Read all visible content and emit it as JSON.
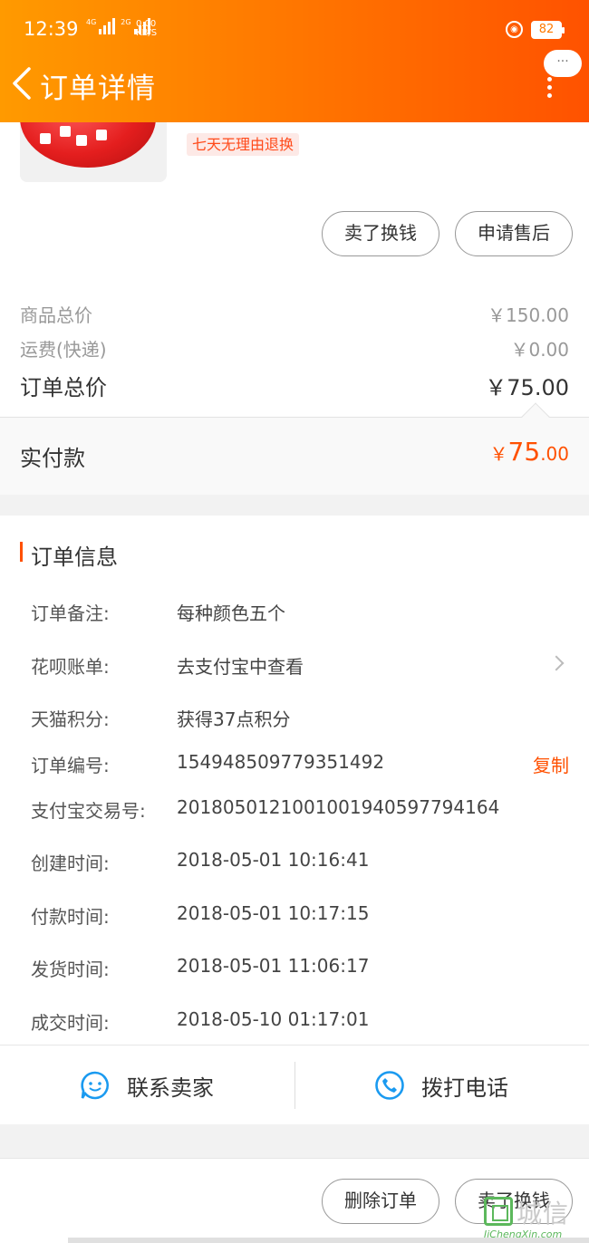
{
  "status_bar": {
    "time": "12:39",
    "net1": "4G",
    "net2": "2G",
    "speed_value": "0.00",
    "speed_unit": "KB/S",
    "battery": "82"
  },
  "header": {
    "title": "订单详情",
    "more_label": "···",
    "bg_start": "#ff9a00",
    "bg_end": "#ff5200"
  },
  "product": {
    "tag": "七天无理由退换",
    "sell_button": "卖了换钱",
    "after_sale_button": "申请售后"
  },
  "prices": {
    "goods_total_label": "商品总价",
    "goods_total_value": "￥150.00",
    "shipping_label": "运费(快递)",
    "shipping_value": "￥0.00",
    "order_total_label": "订单总价",
    "order_total_value": "￥75.00",
    "paid_label": "实付款",
    "paid_currency": "￥",
    "paid_integer": "75",
    "paid_decimal": ".00",
    "accent": "#ff5000"
  },
  "order_info": {
    "title": "订单信息",
    "rows": [
      {
        "key": "订单备注:",
        "value": "每种颜色五个"
      },
      {
        "key": "花呗账单:",
        "value": "去支付宝中查看"
      },
      {
        "key": "天猫积分:",
        "value": "获得37点积分"
      },
      {
        "key": "订单编号:",
        "value": "154948509779351492"
      },
      {
        "key": "支付宝交易号:",
        "value": "2018050121001001940597794164"
      },
      {
        "key": "创建时间:",
        "value": "2018-05-01 10:16:41"
      },
      {
        "key": "付款时间:",
        "value": "2018-05-01 10:17:15"
      },
      {
        "key": "发货时间:",
        "value": "2018-05-01 11:06:17"
      },
      {
        "key": "成交时间:",
        "value": "2018-05-10 01:17:01"
      }
    ],
    "copy_label": "复制"
  },
  "contact": {
    "seller_label": "联系卖家",
    "phone_label": "拨打电话",
    "icon_color": "#1a9af0"
  },
  "bottom": {
    "delete_button": "删除订单",
    "sell_button": "卖了换钱"
  },
  "watermark": {
    "cn": "城信",
    "en": "JiChengXin.com"
  }
}
